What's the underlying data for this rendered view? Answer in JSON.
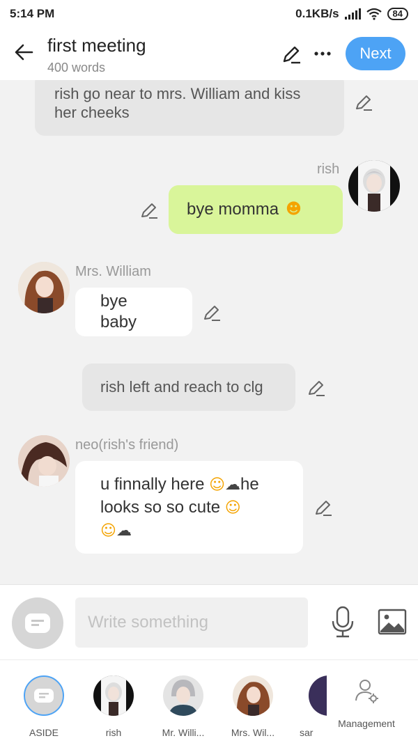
{
  "status_bar": {
    "time": "5:14 PM",
    "network_speed": "0.1KB/s",
    "battery": "84"
  },
  "header": {
    "title": "first meeting",
    "word_count": "400 words",
    "next_label": "Next"
  },
  "chat": {
    "narration_top": "rish go near to mrs. William and kiss her cheeks",
    "msg_rish": {
      "speaker": "rish",
      "text": "bye momma"
    },
    "msg_william": {
      "speaker": "Mrs. William",
      "text": "bye baby"
    },
    "narration_mid": "rish left and reach to clg",
    "msg_neo": {
      "speaker": "neo(rish's friend)",
      "line1": "u finnally here",
      "line1b": "he",
      "line2": "looks so so cute"
    }
  },
  "input": {
    "placeholder": "Write something"
  },
  "characters": [
    {
      "label": "ASIDE"
    },
    {
      "label": "rish"
    },
    {
      "label": "Mr. Willi..."
    },
    {
      "label": "Mrs. Wil..."
    },
    {
      "label": "sar"
    }
  ],
  "management_label": "Management",
  "colors": {
    "accent": "#4da3f5",
    "own_bubble": "#d9f59a",
    "narration_bg": "#e6e6e6"
  }
}
